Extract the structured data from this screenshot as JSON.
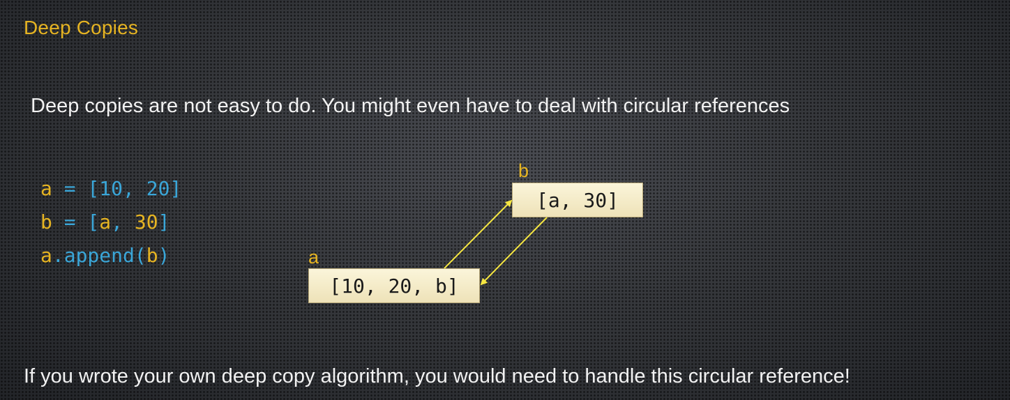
{
  "slide": {
    "title": "Deep Copies",
    "subtitle": "Deep copies are not easy to do. You might even have to deal with circular references",
    "footer": "If you wrote your own deep copy algorithm, you would need to handle this circular reference!"
  },
  "code": {
    "line1": {
      "var": "a",
      "op": " = ",
      "rest": "[10, 20]"
    },
    "line2": {
      "var": "b",
      "op": " = [",
      "inner": "a",
      "sep": ", ",
      "num": "30",
      "close": "]"
    },
    "line3": {
      "obj": "a",
      "method": ".append(",
      "arg": "b",
      "close": ")"
    }
  },
  "diagram": {
    "box_a": {
      "label": "a",
      "content": "[10, 20, b]"
    },
    "box_b": {
      "label": "b",
      "content": "[a, 30]"
    },
    "arrow_color": "#f5e642"
  },
  "colors": {
    "title": "#e6b422",
    "code_var": "#e6b422",
    "code_blue": "#3aa6d8",
    "text": "#f2f2f2",
    "box_fill": "#f5edcc"
  }
}
